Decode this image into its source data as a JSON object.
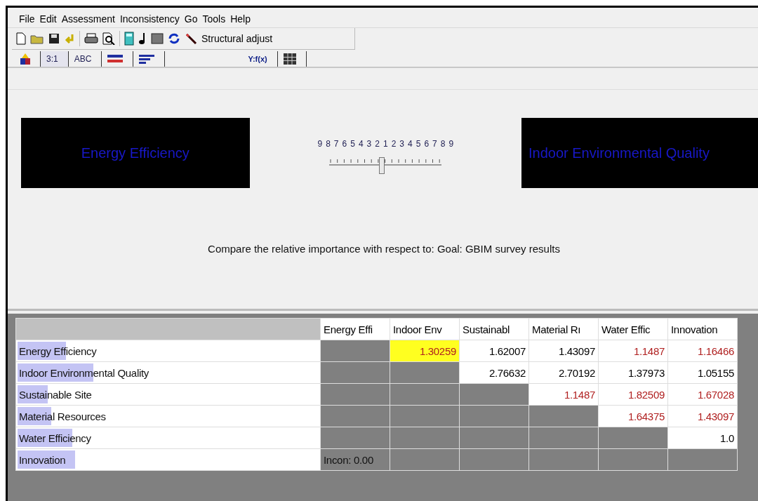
{
  "menu": [
    {
      "label": "File"
    },
    {
      "label": "Edit"
    },
    {
      "label": "Assessment"
    },
    {
      "label": "Inconsistency"
    },
    {
      "label": "Go"
    },
    {
      "label": "Tools"
    },
    {
      "label": "Help"
    }
  ],
  "toolbar": {
    "action_label": "Structural adjust"
  },
  "tabs": [
    {
      "kind": "blocks",
      "selected": false
    },
    {
      "kind": "text",
      "label": "3:1",
      "selected": true
    },
    {
      "kind": "text",
      "label": "ABC",
      "selected": false
    },
    {
      "kind": "equals",
      "selected": false
    },
    {
      "kind": "sort",
      "selected": false
    },
    {
      "kind": "text",
      "label": "Y:f(x)",
      "selected": false
    },
    {
      "kind": "grid",
      "selected": false
    }
  ],
  "comparison": {
    "left": "Energy Efficiency",
    "right": "Indoor Environmental Quality",
    "scale": [
      "9",
      "8",
      "7",
      "6",
      "5",
      "4",
      "3",
      "2",
      "1",
      "2",
      "3",
      "4",
      "5",
      "6",
      "7",
      "8",
      "9"
    ],
    "slider": {
      "level": 0.47
    }
  },
  "caption": "Compare the relative importance  with respect to: Goal: GBIM survey results",
  "table": {
    "columns": [
      "Energy Effi",
      "Indoor Env",
      "Sustainabl",
      "Material Rı",
      "Water Effic",
      "Innovation"
    ],
    "rows": [
      {
        "name": "Energy Efficiency",
        "level": 0.16,
        "cells": [
          {
            "kind": "blank"
          },
          {
            "kind": "value",
            "text": "1.30259",
            "color": "#b02020",
            "selected": true
          },
          {
            "kind": "value",
            "text": "1.62007",
            "color": "#000000",
            "selected": false
          },
          {
            "kind": "value",
            "text": "1.43097",
            "color": "#000000",
            "selected": false
          },
          {
            "kind": "value",
            "text": "1.1487",
            "color": "#b02020",
            "selected": false
          },
          {
            "kind": "value",
            "text": "1.16466",
            "color": "#b02020",
            "selected": false
          }
        ]
      },
      {
        "name": "Indoor Environmental Quality",
        "level": 0.25,
        "cells": [
          {
            "kind": "blank"
          },
          {
            "kind": "blank"
          },
          {
            "kind": "value",
            "text": "2.76632",
            "color": "#000000",
            "selected": false
          },
          {
            "kind": "value",
            "text": "2.70192",
            "color": "#000000",
            "selected": false
          },
          {
            "kind": "value",
            "text": "1.37973",
            "color": "#000000",
            "selected": false
          },
          {
            "kind": "value",
            "text": "1.05155",
            "color": "#000000",
            "selected": false
          }
        ]
      },
      {
        "name": "Sustainable Site",
        "level": 0.1,
        "cells": [
          {
            "kind": "blank"
          },
          {
            "kind": "blank"
          },
          {
            "kind": "blank"
          },
          {
            "kind": "value",
            "text": "1.1487",
            "color": "#b02020",
            "selected": false
          },
          {
            "kind": "value",
            "text": "1.82509",
            "color": "#b02020",
            "selected": false
          },
          {
            "kind": "value",
            "text": "1.67028",
            "color": "#b02020",
            "selected": false
          }
        ]
      },
      {
        "name": "Material Resources",
        "level": 0.11,
        "cells": [
          {
            "kind": "blank"
          },
          {
            "kind": "blank"
          },
          {
            "kind": "blank"
          },
          {
            "kind": "blank"
          },
          {
            "kind": "value",
            "text": "1.64375",
            "color": "#b02020",
            "selected": false
          },
          {
            "kind": "value",
            "text": "1.43097",
            "color": "#b02020",
            "selected": false
          }
        ]
      },
      {
        "name": "Water Efficiency",
        "level": 0.18,
        "cells": [
          {
            "kind": "blank"
          },
          {
            "kind": "blank"
          },
          {
            "kind": "blank"
          },
          {
            "kind": "blank"
          },
          {
            "kind": "blank"
          },
          {
            "kind": "value",
            "text": "1.0",
            "color": "#000000",
            "selected": false
          }
        ]
      },
      {
        "name": "Innovation",
        "level": 0.19,
        "cells": [
          {
            "kind": "note",
            "text": "Incon: 0.00"
          },
          {
            "kind": "blank"
          },
          {
            "kind": "blank"
          },
          {
            "kind": "blank"
          },
          {
            "kind": "blank"
          },
          {
            "kind": "blank"
          }
        ]
      }
    ]
  }
}
